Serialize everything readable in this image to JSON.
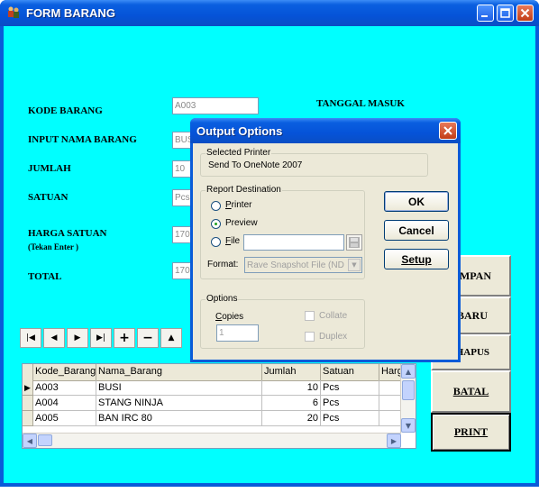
{
  "window": {
    "title": "FORM BARANG",
    "icon": "app-icon"
  },
  "form": {
    "kode_barang_label": "KODE BARANG",
    "kode_barang_value": "A003",
    "tanggal_masuk_label": "TANGGAL MASUK",
    "nama_barang_label": "INPUT NAMA BARANG",
    "nama_barang_value": "BUSI",
    "jumlah_label": "JUMLAH",
    "jumlah_value": "10",
    "satuan_label": "SATUAN",
    "satuan_value": "Pcs",
    "harga_label": "HARGA SATUAN",
    "harga_hint": "(Tekan Enter )",
    "harga_value": "1700",
    "total_label": "TOTAL",
    "total_value": "1700"
  },
  "navigator": {
    "buttons": [
      "first",
      "prior",
      "next",
      "last",
      "insert",
      "delete",
      "edit"
    ]
  },
  "grid": {
    "columns": [
      "Kode_Barang",
      "Nama_Barang",
      "Jumlah",
      "Satuan",
      "Harg"
    ],
    "rows": [
      {
        "kode": "A003",
        "nama": "BUSI",
        "jumlah": "10",
        "satuan": "Pcs"
      },
      {
        "kode": "A004",
        "nama": "STANG NINJA",
        "jumlah": "6",
        "satuan": "Pcs"
      },
      {
        "kode": "A005",
        "nama": "BAN IRC 80",
        "jumlah": "20",
        "satuan": "Pcs"
      }
    ],
    "current_row_marker": "▶"
  },
  "actions": {
    "simpan": "SIMPAN",
    "baru": "BARU",
    "hapus": "HAPUS",
    "batal": "BATAL",
    "print": "PRINT"
  },
  "dialog": {
    "title": "Output Options",
    "selected_printer_label": "Selected Printer",
    "selected_printer_value": "Send To OneNote 2007",
    "report_destination_label": "Report Destination",
    "printer_option": "Printer",
    "preview_option": "Preview",
    "file_option": "File",
    "selected_destination": "Preview",
    "format_label": "Format:",
    "format_value": "Rave Snapshot File (ND",
    "options_label": "Options",
    "copies_label": "Copies",
    "copies_value": "1",
    "collate_label": "Collate",
    "duplex_label": "Duplex",
    "ok_label": "OK",
    "cancel_label": "Cancel",
    "setup_label": "Setup"
  },
  "colors": {
    "form_background": "#00ffff",
    "titlebar": "#0553d8",
    "dialog_face": "#ece9d8"
  }
}
